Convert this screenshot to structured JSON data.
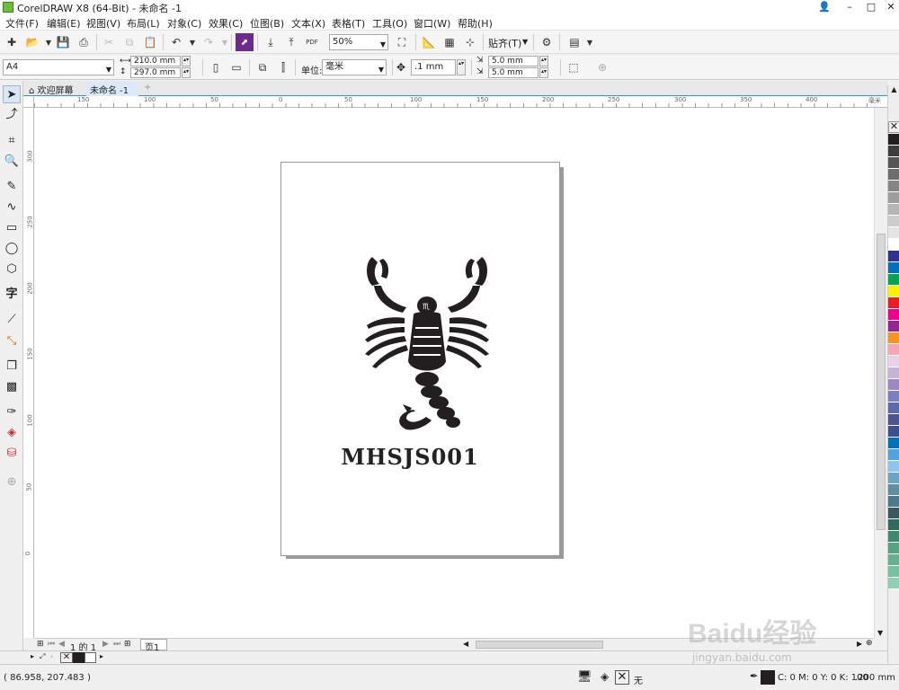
{
  "window": {
    "title": "CorelDRAW X8 (64-Bit) - 未命名 -1",
    "controls": [
      "–",
      "□",
      "✕"
    ]
  },
  "menu": [
    "文件(F)",
    "编辑(E)",
    "视图(V)",
    "布局(L)",
    "对象(C)",
    "效果(C)",
    "位图(B)",
    "文本(X)",
    "表格(T)",
    "工具(O)",
    "窗口(W)",
    "帮助(H)"
  ],
  "toolbar": {
    "zoom_value": "50%",
    "snap_label": "贴齐(T)",
    "pdf_label": "PDF"
  },
  "property_bar": {
    "paper_size": "A4",
    "width": "210.0 mm",
    "height": "297.0 mm",
    "unit_label": "单位:",
    "unit_value": "毫米",
    "nudge": ".1 mm",
    "dup_x": "5.0 mm",
    "dup_y": "5.0 mm"
  },
  "document_tabs": [
    {
      "label": "欢迎屏幕",
      "active": false
    },
    {
      "label": "未命名 -1",
      "active": true
    }
  ],
  "rulers": {
    "horizontal_ticks": [
      "150",
      "100",
      "50",
      "0",
      "50",
      "100",
      "150",
      "200",
      "250",
      "300",
      "350",
      "400"
    ],
    "horizontal_unit": "毫米",
    "vertical_ticks": [
      "300",
      "250",
      "200",
      "150",
      "100",
      "50",
      "0"
    ]
  },
  "canvas": {
    "artwork_text": "MHSJS001",
    "artwork_icon": "scorpion-icon"
  },
  "page_nav": {
    "page_count_text": "1 的 1",
    "page_tab": "页1"
  },
  "palette_colors": [
    "#231f20",
    "#3d3d3d",
    "#555555",
    "#6d6d6d",
    "#858585",
    "#9d9d9d",
    "#b5b5b5",
    "#cdcdcd",
    "#e5e5e5",
    "#ffffff",
    "#2e3192",
    "#0071bc",
    "#00a651",
    "#fff200",
    "#ed1c24",
    "#ec008c",
    "#92278f",
    "#f7941d",
    "#f5a6b0",
    "#e6d3e8",
    "#c7b3d9",
    "#9c89c4",
    "#7b7fbf",
    "#5b6aa8",
    "#4a5590",
    "#3c4f8f",
    "#0072bc",
    "#4fa3df",
    "#8cc6ee",
    "#6aa5c3",
    "#5f8ea1",
    "#4d7a8b",
    "#39595f",
    "#2f6b5a",
    "#3f8a6e",
    "#55a383",
    "#66b08f",
    "#79c0a0",
    "#8dd0b3"
  ],
  "status": {
    "coordinates": "( 86.958, 207.483 )",
    "fill_label": "无",
    "color_values": "C: 0 M: 0 Y: 0 K: 100",
    "outline_width": ".200 mm"
  },
  "watermark": {
    "text1": "Baidu经验",
    "text2": "jingyan.baidu.com"
  }
}
